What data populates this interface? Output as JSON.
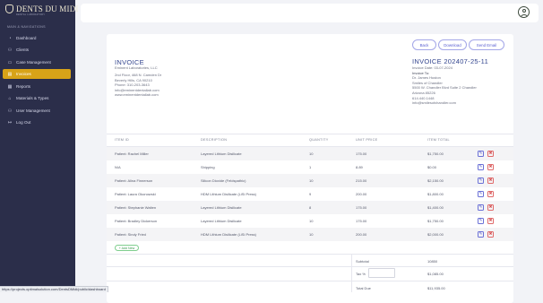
{
  "brand": {
    "name": "DENTS DU MIDI",
    "tagline": "DENTAL LABORATORY"
  },
  "sidebar": {
    "heading": "MAIN & NAVIGATIONS",
    "items": [
      {
        "label": "Dashboard",
        "icon": "dashboard-icon",
        "glyph": "◔"
      },
      {
        "label": "Clients",
        "icon": "users-icon",
        "glyph": "⚇"
      },
      {
        "label": "Case Management",
        "icon": "folder-icon",
        "glyph": "▭"
      },
      {
        "label": "Invoices",
        "icon": "invoice-icon",
        "glyph": "▤",
        "active": true
      },
      {
        "label": "Reports",
        "icon": "report-icon",
        "glyph": "▦"
      },
      {
        "label": "Materials & Types",
        "icon": "tag-icon",
        "glyph": "⌂"
      },
      {
        "label": "User Management",
        "icon": "user-icon",
        "glyph": "⚇"
      },
      {
        "label": "Log Out",
        "icon": "logout-icon",
        "glyph": "↦"
      }
    ]
  },
  "actions": {
    "back": "Back",
    "download": "Download",
    "send": "Send Email"
  },
  "invoice": {
    "title": "INVOICE",
    "number": "INVOICE 202407-25-11",
    "date": "Invoice Date: 03-07-2024",
    "from": {
      "company": "Eminent Laboratories, LLC",
      "address1": "2nd Floor, 468 N. Camden Dr",
      "address2": "Beverly Hills, CA 90210",
      "phone": "Phone: 310-203-3643",
      "email": "info@eminentdentallab.com",
      "web": "www.eminentdentallab.com"
    },
    "to": {
      "label": "Invoice To:",
      "name": "Dr. James Huston",
      "practice": "Smiles of Chandler",
      "address1": "5500 W. Chandler Blvd Suite 2 Chandler",
      "address2": "Arizona 85226",
      "phone": "614.440.1448",
      "email": "info@smilesofchandler.com"
    }
  },
  "table": {
    "headers": [
      "ITEM ID",
      "DESCRIPTION",
      "QUANTITY",
      "UNIT PRICE",
      "ITEM TOTAL"
    ],
    "rows": [
      {
        "id": "Patient: Rachel Miller",
        "desc": "Layered Lithium Disilicate",
        "qty": "10",
        "price": "175.00",
        "total": "$1,750.00"
      },
      {
        "id": "N/A",
        "desc": "Shipping",
        "qty": "1",
        "price": "8.89",
        "total": "$0.00"
      },
      {
        "id": "Patient: Alina Finnerson",
        "desc": "Silicon Dioxide (Feldspathic)",
        "qty": "10",
        "price": "215.00",
        "total": "$2,150.00"
      },
      {
        "id": "Patient: Laura Okonowski",
        "desc": "HDM Lithium Disilicate (LiSi Press)",
        "qty": "9",
        "price": "200.00",
        "total": "$1,800.00"
      },
      {
        "id": "Patient: Stephanie Walten",
        "desc": "Layered Lithium Disilicate",
        "qty": "8",
        "price": "175.00",
        "total": "$1,400.00"
      },
      {
        "id": "Patient: Bradley Dickerson",
        "desc": "Layered Lithium Disilicate",
        "qty": "10",
        "price": "175.00",
        "total": "$1,750.00"
      },
      {
        "id": "Patient: Sindy Fried",
        "desc": "HDM Lithium Disilicate (LiSi Press)",
        "qty": "10",
        "price": "200.00",
        "total": "$2,000.00"
      }
    ],
    "add_new": "+ Add New"
  },
  "summary": {
    "subtotal_label": "Subtotal",
    "subtotal": "10850",
    "tax_label": "Tax %",
    "tax": "$1,085.00",
    "total_label": "Total Due",
    "total": "$11,935.00"
  },
  "status_url": "https://projects.optimalsolution.com/DentsDMidi/public/dashboard"
}
